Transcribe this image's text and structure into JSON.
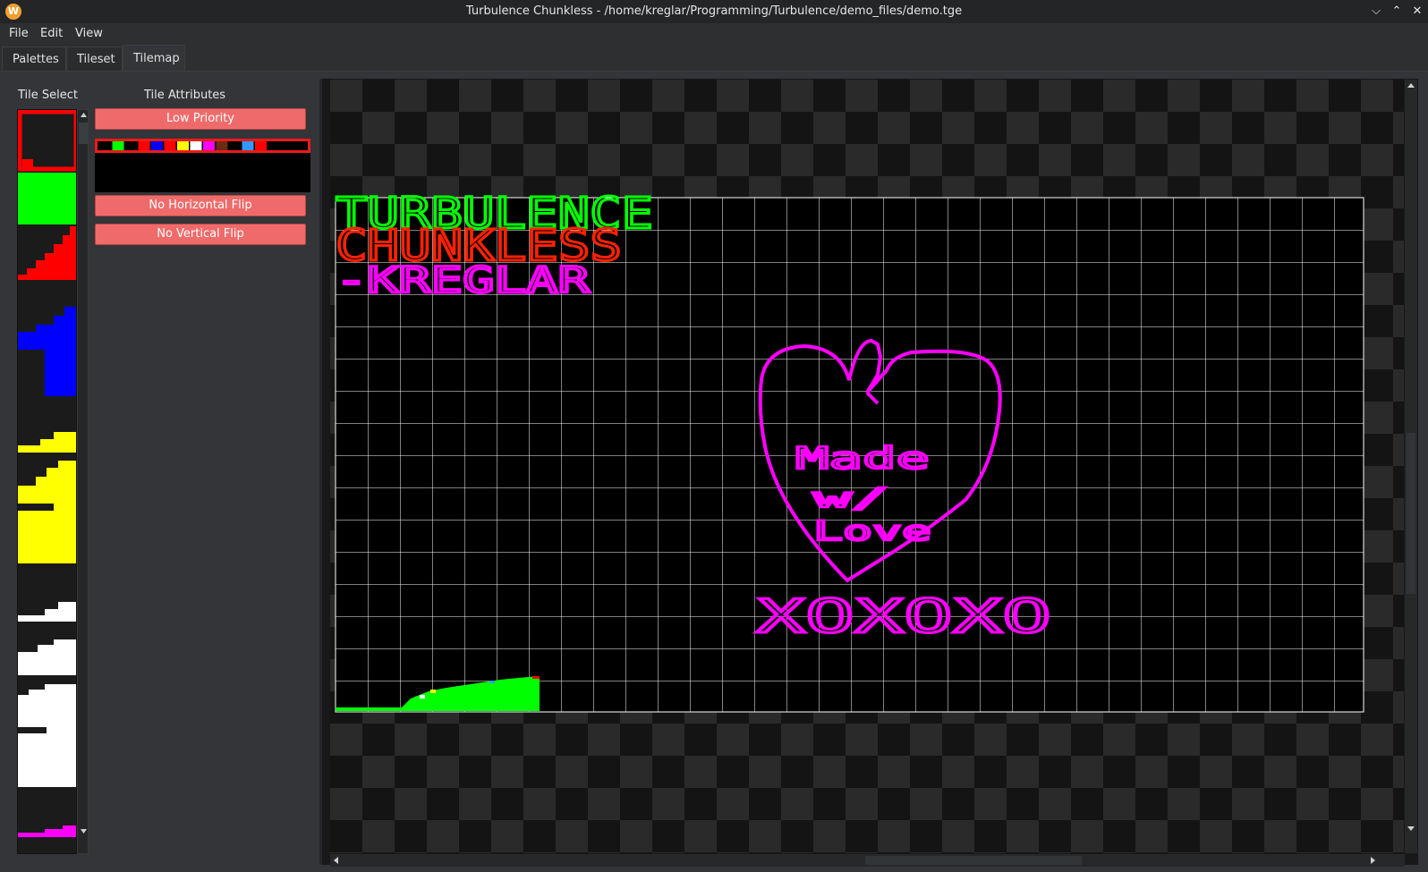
{
  "window": {
    "title": "Turbulence Chunkless - /home/kreglar/Programming/Turbulence/demo_files/demo.tge",
    "app_icon": "W",
    "buttons": {
      "minimize": "⌵",
      "maximize": "⌃",
      "close": "✕"
    }
  },
  "menubar": {
    "items": [
      "File",
      "Edit",
      "View"
    ]
  },
  "tabs": {
    "items": [
      "Palettes",
      "Tileset",
      "Tilemap"
    ],
    "active": "Tilemap"
  },
  "tile_select": {
    "label": "Tile Select"
  },
  "tile_attributes": {
    "label": "Tile Attributes",
    "priority_button": "Low Priority",
    "hflip_button": "No Horizontal Flip",
    "vflip_button": "No Vertical Flip",
    "palette_colors": [
      "#000000",
      "#00ff00",
      "#000000",
      "#ff0000",
      "#0000ff",
      "#ff0000",
      "#ffff00",
      "#ffffff",
      "#ff00ff",
      "#6b2a12",
      "#000000",
      "#3399ff",
      "#ff0000"
    ]
  },
  "tilemap": {
    "title_line_1": "TURBULENCE",
    "title_line_2": "CHUNKLESS",
    "title_line_3": "-KREGLAR",
    "heart_text_1": "Made",
    "heart_text_2": "w/",
    "heart_text_3": "Love",
    "signoff": "XOXOXO",
    "colors": {
      "green": "#00ff00",
      "red": "#ff2200",
      "magenta": "#ff00ff",
      "grid": "#ffffff"
    }
  }
}
